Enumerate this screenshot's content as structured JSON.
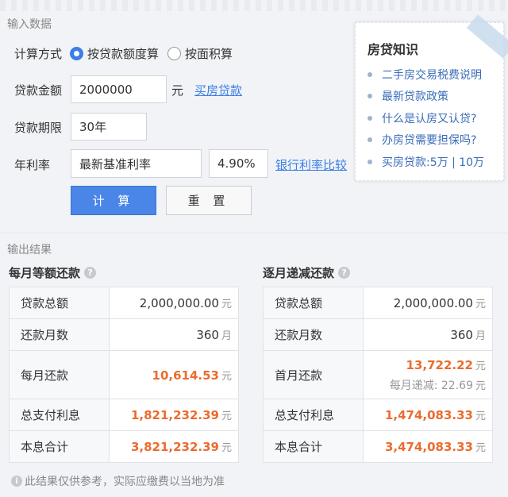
{
  "input_section": {
    "title": "输入数据",
    "calc_method": {
      "label": "计算方式",
      "options": [
        {
          "label": "按贷款额度算",
          "checked": true
        },
        {
          "label": "按面积算",
          "checked": false
        }
      ]
    },
    "loan_amount": {
      "label": "贷款金额",
      "value": "2000000",
      "unit": "元",
      "link": "买房贷款"
    },
    "loan_term": {
      "label": "贷款期限",
      "value": "30年"
    },
    "interest_rate": {
      "label": "年利率",
      "rate_type": "最新基准利率",
      "rate_value": "4.90%",
      "link": "银行利率比较"
    },
    "buttons": {
      "calculate": "计 算",
      "reset": "重 置"
    }
  },
  "knowledge": {
    "title": "房贷知识",
    "items": [
      "二手房交易税费说明",
      "最新贷款政策",
      "什么是认房又认贷?",
      "办房贷需要担保吗?",
      "买房贷款:5万 | 10万"
    ]
  },
  "output_section": {
    "title": "输出结果",
    "equal_payment": {
      "title": "每月等额还款",
      "rows": [
        {
          "key": "贷款总额",
          "value": "2,000,000.00",
          "unit": "元",
          "highlight": false
        },
        {
          "key": "还款月数",
          "value": "360",
          "unit": "月",
          "highlight": false
        },
        {
          "key": "每月还款",
          "value": "10,614.53",
          "unit": "元",
          "highlight": true
        },
        {
          "key": "总支付利息",
          "value": "1,821,232.39",
          "unit": "元",
          "highlight": true
        },
        {
          "key": "本息合计",
          "value": "3,821,232.39",
          "unit": "元",
          "highlight": true
        }
      ]
    },
    "decreasing_payment": {
      "title": "逐月递减还款",
      "rows": [
        {
          "key": "贷款总额",
          "value": "2,000,000.00",
          "unit": "元",
          "highlight": false
        },
        {
          "key": "还款月数",
          "value": "360",
          "unit": "月",
          "highlight": false
        },
        {
          "key": "首月还款",
          "value": "13,722.22",
          "unit": "元",
          "highlight": true,
          "note_label": "每月递减:",
          "note_value": "22.69",
          "note_unit": "元"
        },
        {
          "key": "总支付利息",
          "value": "1,474,083.33",
          "unit": "元",
          "highlight": true
        },
        {
          "key": "本息合计",
          "value": "3,474,083.33",
          "unit": "元",
          "highlight": true
        }
      ]
    }
  },
  "footer_note": "此结果仅供参考，实际应缴费以当地为准",
  "colors": {
    "accent": "#4a86e8",
    "highlight": "#ec6b2d",
    "link": "#3a7ee8"
  }
}
